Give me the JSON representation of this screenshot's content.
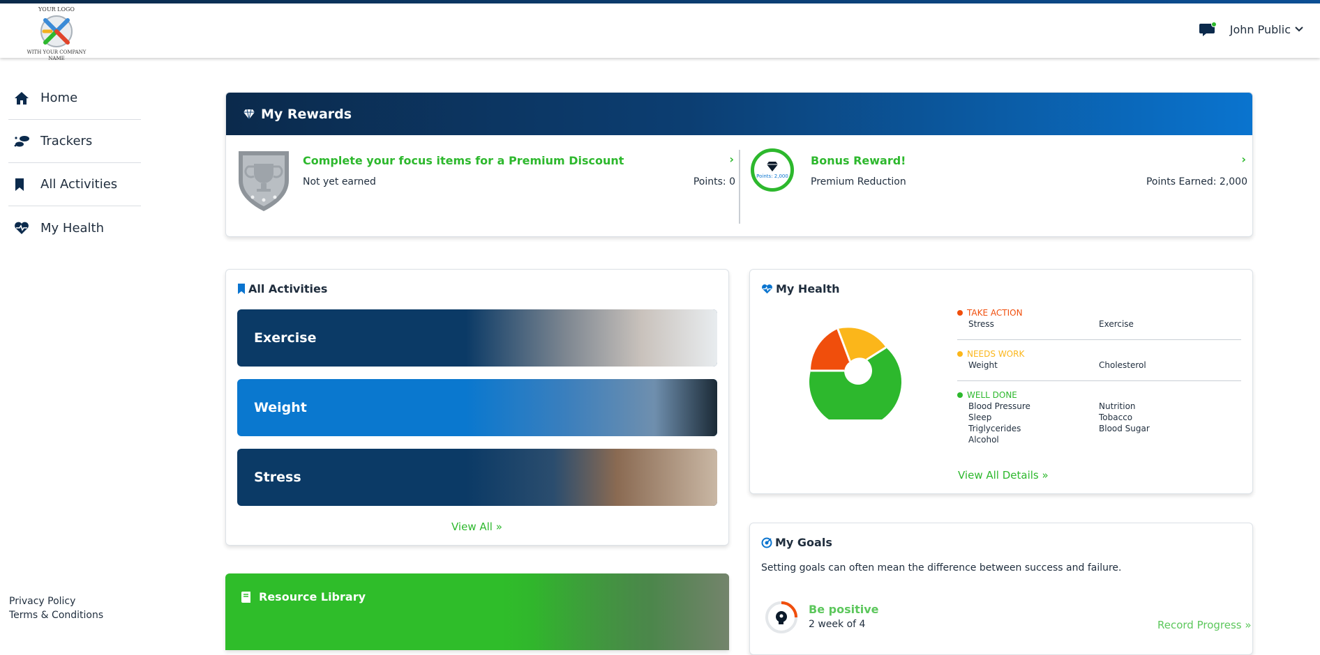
{
  "header": {
    "logo_line1": "YOUR LOGO",
    "logo_line2": "WITH YOUR COMPANY NAME",
    "user_name": "John Public",
    "message_icon": "chat-bubble-icon",
    "colors": {
      "topbar": "#0b3c6e",
      "accent_green": "#2db82d",
      "accent_blue": "#0a74cf"
    }
  },
  "sidebar": {
    "items": [
      {
        "label": "Home",
        "icon": "home-icon"
      },
      {
        "label": "Trackers",
        "icon": "footprints-icon"
      },
      {
        "label": "All Activities",
        "icon": "bookmark-icon"
      },
      {
        "label": "My Health",
        "icon": "heart-pulse-icon"
      }
    ],
    "footer": {
      "privacy": "Privacy Policy",
      "terms": "Terms & Conditions"
    }
  },
  "rewards": {
    "title": "My Rewards",
    "left": {
      "title": "Complete your focus items for a Premium Discount",
      "status": "Not yet earned",
      "points": "Points: 0"
    },
    "right": {
      "badge_points": "Points: 2,000",
      "title": "Bonus Reward!",
      "subtitle": "Premium Reduction",
      "points": "Points Earned: 2,000"
    }
  },
  "activities": {
    "title": "All Activities",
    "tiles": [
      {
        "label": "Exercise",
        "color": "#0b3a66"
      },
      {
        "label": "Weight",
        "color": "#0a78cf"
      },
      {
        "label": "Stress",
        "color": "#0b3a66"
      }
    ],
    "view_all": "View All"
  },
  "library": {
    "title": "Resource Library"
  },
  "health": {
    "title": "My Health",
    "groups": [
      {
        "status": "TAKE ACTION",
        "color": "#f04e0c",
        "items": [
          "Stress",
          "Exercise"
        ]
      },
      {
        "status": "NEEDS WORK",
        "color": "#fbb61a",
        "items": [
          "Weight",
          "Cholesterol"
        ]
      },
      {
        "status": "WELL DONE",
        "color": "#2db82d",
        "items": [
          "Blood Pressure",
          "Nutrition",
          "Sleep",
          "Tobacco",
          "Triglycerides",
          "Blood Sugar",
          "Alcohol"
        ]
      }
    ],
    "view_all": "View All Details"
  },
  "goals": {
    "title": "My Goals",
    "description": "Setting goals can often mean the difference between success and failure.",
    "goal": {
      "title": "Be positive",
      "progress_text": "2 week of 4",
      "progress_fraction": 0.5
    },
    "record": "Record Progress"
  }
}
